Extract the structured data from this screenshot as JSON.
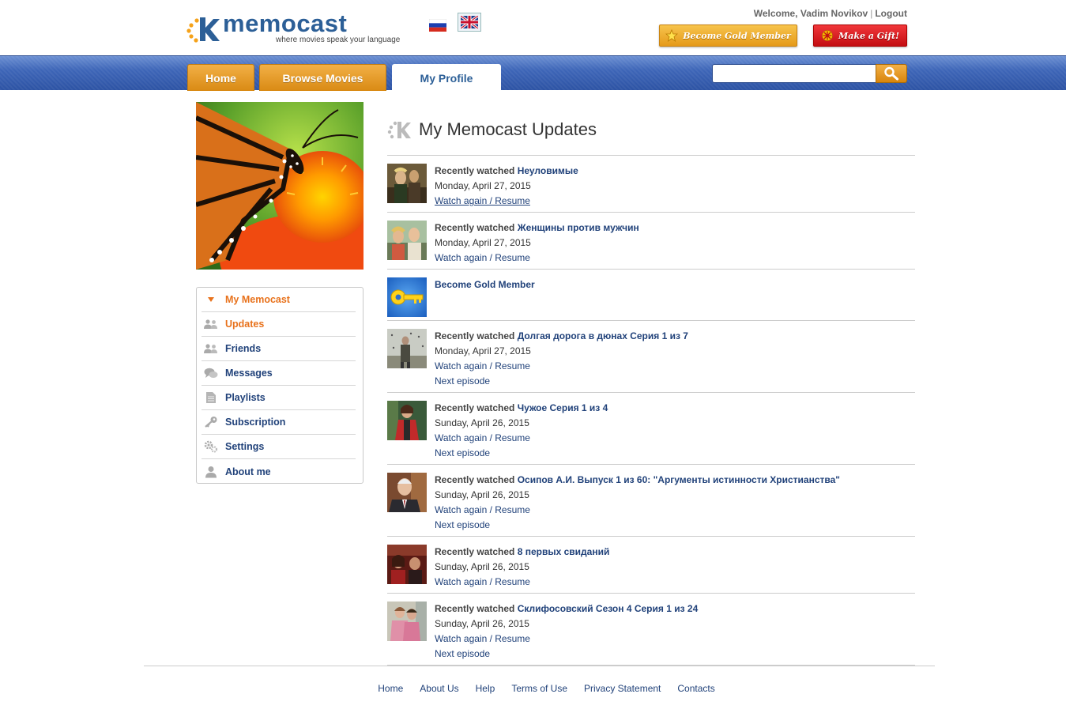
{
  "brand": {
    "name_part1": "memo",
    "name_part2": "cast",
    "tagline": "where movies speak your language"
  },
  "header": {
    "welcome_text": "Welcome, Vadim Novikov",
    "separator": "|",
    "logout_label": "Logout",
    "gold_button_label": "Become Gold Member",
    "gift_button_label": "Make a Gift!",
    "languages": [
      {
        "code": "ru",
        "icon": "russia-flag-icon",
        "selected": false
      },
      {
        "code": "en",
        "icon": "uk-flag-icon",
        "selected": true
      }
    ]
  },
  "nav": {
    "tabs": [
      {
        "label": "Home",
        "active": false
      },
      {
        "label": "Browse Movies",
        "active": false
      },
      {
        "label": "My Profile",
        "active": true
      }
    ],
    "search": {
      "value": "",
      "placeholder": ""
    }
  },
  "sidebar": {
    "menu": [
      {
        "label": "My Memocast",
        "icon": "triangle-down-icon",
        "state": "header"
      },
      {
        "label": "Updates",
        "icon": "users-icon",
        "state": "current"
      },
      {
        "label": "Friends",
        "icon": "users-icon",
        "state": "normal"
      },
      {
        "label": "Messages",
        "icon": "chat-bubbles-icon",
        "state": "normal"
      },
      {
        "label": "Playlists",
        "icon": "document-icon",
        "state": "normal"
      },
      {
        "label": "Subscription",
        "icon": "key-icon",
        "state": "normal"
      },
      {
        "label": "Settings",
        "icon": "gears-icon",
        "state": "normal"
      },
      {
        "label": "About me",
        "icon": "person-icon",
        "state": "normal"
      }
    ]
  },
  "main": {
    "title": "My Memocast Updates",
    "updates": [
      {
        "prefix": "Recently watched",
        "title": "Неуловимые",
        "date": "Monday, April 27, 2015",
        "watch_label": "Watch again / Resume",
        "next_label": ""
      },
      {
        "prefix": "Recently watched",
        "title": "Женщины против мужчин",
        "date": "Monday, April 27, 2015",
        "watch_label": "Watch again / Resume",
        "next_label": ""
      },
      {
        "prefix": "",
        "title": "Become Gold Member",
        "date": "",
        "watch_label": "",
        "next_label": ""
      },
      {
        "prefix": "Recently watched",
        "title": "Долгая дорога в дюнах Серия 1 из 7",
        "date": "Monday, April 27, 2015",
        "watch_label": "Watch again / Resume",
        "next_label": "Next episode"
      },
      {
        "prefix": "Recently watched",
        "title": "Чужое Серия 1 из 4",
        "date": "Sunday, April 26, 2015",
        "watch_label": "Watch again / Resume",
        "next_label": "Next episode"
      },
      {
        "prefix": "Recently watched",
        "title": "Осипов А.И. Выпуск 1 из 60: \"Аргументы истинности Христианства\"",
        "date": "Sunday, April 26, 2015",
        "watch_label": "Watch again / Resume",
        "next_label": "Next episode"
      },
      {
        "prefix": "Recently watched",
        "title": "8 первых свиданий",
        "date": "Sunday, April 26, 2015",
        "watch_label": "Watch again / Resume",
        "next_label": ""
      },
      {
        "prefix": "Recently watched",
        "title": "Склифосовский Сезон 4 Серия 1 из 24",
        "date": "Sunday, April 26, 2015",
        "watch_label": "Watch again / Resume",
        "next_label": "Next episode"
      }
    ]
  },
  "footer": {
    "links": [
      "Home",
      "About Us",
      "Help",
      "Terms of Use",
      "Privacy Statement",
      "Contacts"
    ]
  },
  "colors": {
    "brand_blue": "#2c5f97",
    "link_blue": "#21427a",
    "accent_orange": "#e8721c",
    "gold_button": "#e59a1a",
    "gift_button": "#c30d12"
  }
}
